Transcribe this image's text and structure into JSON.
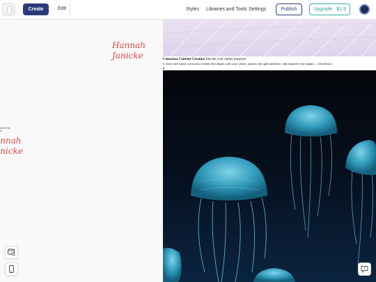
{
  "toolbar": {
    "create_label": "Create",
    "edit_label": "Edit",
    "nav": [
      "Styles",
      "Libraries and Tools",
      "Settings"
    ],
    "publish_label": "Publish",
    "upgrade_label": "Upgrade · $1.9"
  },
  "canvas": {
    "script_name_line1": "Hannah",
    "script_name_line2": "Janicke",
    "script_name_partial_line1": "annah",
    "script_name_partial_line2": "anicke",
    "small_note_line1": "me to my",
    "small_note_line2": "lo"
  },
  "preview": {
    "intro_heading": "Conscious Content Creation",
    "intro_tagline": "Elevate your online presence",
    "intro_body": "I create and curate conscious content that aligns with your values, attracts the right audience, and expands your impact – effortlessly.",
    "intro_arrow": "▸"
  },
  "icons": {
    "preview_tool": "window-search-icon",
    "mobile_tool": "mobile-phone-icon",
    "feedback": "chat-feedback-icon"
  },
  "colors": {
    "brand": "#2b3b7a",
    "accent": "#2fb3a8",
    "script": "#e0483e"
  }
}
